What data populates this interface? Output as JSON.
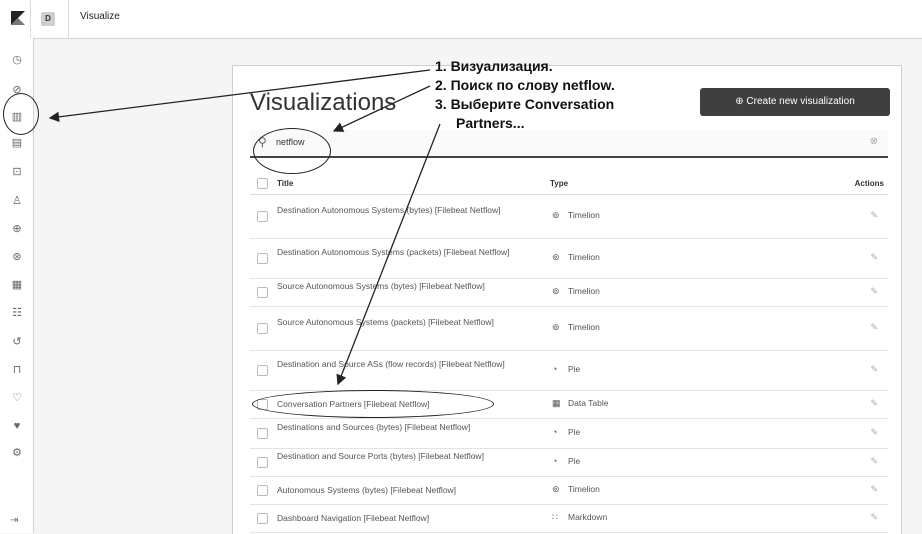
{
  "breadcrumb": {
    "space": "D",
    "current": "Visualize"
  },
  "main": {
    "title": "Visualizations",
    "create_button": "Create new visualization",
    "search_value": "netflow"
  },
  "table": {
    "headers": {
      "title": "Title",
      "type": "Type",
      "actions": "Actions"
    },
    "rows": [
      {
        "title": "Destination Autonomous Systems (bytes) [Filebeat Netflow]",
        "type": "Timelion",
        "icon": "timelion-icon"
      },
      {
        "title": "Destination Autonomous Systems (packets) [Filebeat Netflow]",
        "type": "Timelion",
        "icon": "timelion-icon"
      },
      {
        "title": "Source Autonomous Systems (bytes) [Filebeat Netflow]",
        "type": "Timelion",
        "icon": "timelion-icon"
      },
      {
        "title": "Source Autonomous Systems (packets) [Filebeat Netflow]",
        "type": "Timelion",
        "icon": "timelion-icon"
      },
      {
        "title": "Destination and Source ASs (flow records) [Filebeat Netflow]",
        "type": "Pie",
        "icon": "pie-icon"
      },
      {
        "title": "Conversation Partners [Filebeat Netflow]",
        "type": "Data Table",
        "icon": "table-icon"
      },
      {
        "title": "Destinations and Sources (bytes) [Filebeat Netflow]",
        "type": "Pie",
        "icon": "pie-icon"
      },
      {
        "title": "Destination and Source Ports (bytes) [Filebeat Netflow]",
        "type": "Pie",
        "icon": "pie-icon"
      },
      {
        "title": "Autonomous Systems (bytes) [Filebeat Netflow]",
        "type": "Timelion",
        "icon": "timelion-icon"
      },
      {
        "title": "Dashboard Navigation [Filebeat Netflow]",
        "type": "Markdown",
        "icon": "markdown-icon"
      }
    ]
  },
  "annotation": {
    "lines": [
      "1. Визуализация.",
      "2. Поиск по слову netflow.",
      "3. Выберите Conversation",
      "Partners..."
    ]
  },
  "sidenav": {
    "icons": [
      "recent-icon",
      "discover-icon",
      "visualize-icon",
      "dashboard-icon",
      "canvas-icon",
      "maps-icon",
      "ml-icon",
      "infrastructure-icon",
      "logs-icon",
      "apm-icon",
      "uptime-icon",
      "siem-icon",
      "dev-tools-icon",
      "monitoring-icon",
      "management-icon"
    ]
  }
}
